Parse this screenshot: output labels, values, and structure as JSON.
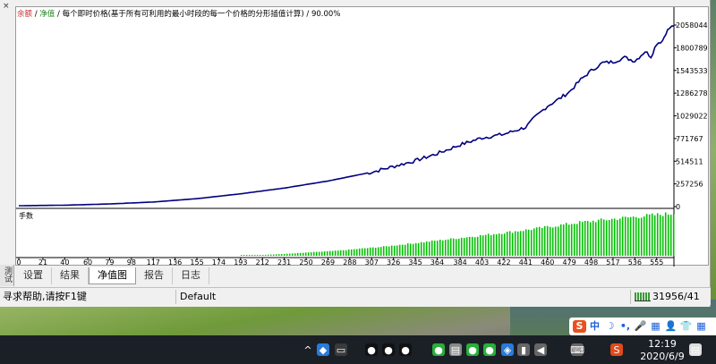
{
  "window": {
    "side_tab_label": "测试",
    "side_close": "×"
  },
  "legend": {
    "balance_label": "余额",
    "separator": " / ",
    "equity_label": "净值",
    "rest": " / 每个即时价格(基于所有可利用的最小时段的每一个价格的分形插值计算) / 90.00%"
  },
  "tabs": [
    {
      "label": "设置",
      "active": false
    },
    {
      "label": "结果",
      "active": false
    },
    {
      "label": "净值图",
      "active": true
    },
    {
      "label": "报告",
      "active": false
    },
    {
      "label": "日志",
      "active": false
    }
  ],
  "statusbar": {
    "help": "寻求帮助,请按F1键",
    "profile": "Default",
    "connection": "31956/41"
  },
  "taskbar": {
    "time": "12:19",
    "date": "2020/6/9",
    "ime_labels": [
      "S",
      "中",
      "☽",
      "•,",
      "🎤",
      "▦",
      "👤",
      "👕",
      "▦"
    ],
    "tray_icons": [
      "chevron-up-icon",
      "app-icon",
      "display-icon",
      "qq-icon",
      "qq-icon",
      "qq-icon",
      "wechat-icon",
      "computer-icon",
      "wechat-icon",
      "network-icon",
      "shield-icon",
      "tablet-icon",
      "speaker-icon",
      "keyboard-icon",
      "ime-icon",
      "notification-icon"
    ]
  },
  "chart_data": {
    "type": "line",
    "title": "",
    "ylabel": "",
    "xlabel": "",
    "y_ticks": [
      "2058044",
      "1800789",
      "1543533",
      "1286278",
      "1029022",
      "771767",
      "514511",
      "257256",
      "0"
    ],
    "x_ticks": [
      "0",
      "21",
      "40",
      "60",
      "79",
      "98",
      "117",
      "136",
      "155",
      "174",
      "193",
      "212",
      "231",
      "250",
      "269",
      "288",
      "307",
      "326",
      "345",
      "364",
      "384",
      "403",
      "422",
      "441",
      "460",
      "479",
      "498",
      "517",
      "536",
      "555"
    ],
    "ylim": [
      0,
      2058044
    ],
    "xlim": [
      0,
      570
    ],
    "series": [
      {
        "name": "净值",
        "color": "#00007f",
        "x": [
          0,
          40,
          79,
          117,
          155,
          193,
          231,
          269,
          307,
          345,
          364,
          384,
          403,
          422,
          441,
          449,
          460,
          470,
          479,
          489,
          498,
          508,
          517,
          527,
          536,
          545,
          550,
          555,
          560,
          563,
          566,
          570
        ],
        "y": [
          10000,
          16000,
          30000,
          52000,
          90000,
          145000,
          210000,
          290000,
          390000,
          520000,
          600000,
          700000,
          780000,
          820000,
          900000,
          1010000,
          1140000,
          1220000,
          1300000,
          1440000,
          1540000,
          1630000,
          1640000,
          1690000,
          1650000,
          1760000,
          1700000,
          1850000,
          1880000,
          1970000,
          2020000,
          2050000
        ]
      }
    ],
    "lots_panel": {
      "label": "手数",
      "color": "#00c000",
      "x_start": 193,
      "x_end": 570,
      "profile": [
        0.0,
        0.05,
        0.12,
        0.22,
        0.35,
        0.48,
        0.62,
        0.78,
        0.9,
        1.0
      ]
    }
  }
}
